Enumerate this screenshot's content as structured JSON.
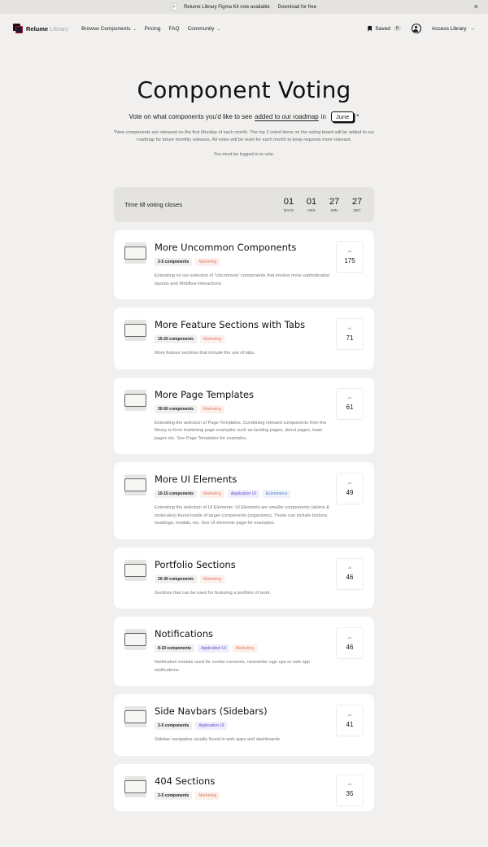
{
  "banner": {
    "message": "Relume Library Figma Kit now available",
    "cta": "Download for free",
    "close_icon": "×"
  },
  "nav": {
    "logo_primary": "Relume",
    "logo_secondary": "Library",
    "links": [
      {
        "label": "Browse Components",
        "dropdown": true
      },
      {
        "label": "Pricing",
        "dropdown": false
      },
      {
        "label": "FAQ",
        "dropdown": false
      },
      {
        "label": "Community",
        "dropdown": true
      }
    ],
    "saved_label": "Saved",
    "saved_count": "0",
    "access_label": "Access Library",
    "access_arrow": "→"
  },
  "hero": {
    "title": "Component Voting",
    "subtitle_pre": "Vote on what components you'd like to see",
    "subtitle_link": "added to our roadmap",
    "subtitle_in": "in",
    "month": "June",
    "asterisk": "*",
    "note": "*New components are released on the first Monday of each month. The top 2 voted items on the voting board will be added to our roadmap for future monthly releases. All votes will be reset for each month to keep requests more relevant.",
    "login_note": "You must be logged in to vote."
  },
  "timer": {
    "label": "Time till voting closes",
    "units": [
      {
        "value": "01",
        "caption": "DAYS"
      },
      {
        "value": "01",
        "caption": "HRS"
      },
      {
        "value": "27",
        "caption": "MIN"
      },
      {
        "value": "27",
        "caption": "SEC"
      }
    ]
  },
  "colors": {
    "background": "#f1f0ee",
    "marketing_tag": "#e07a5f",
    "appui_tag": "#5b4fc9",
    "ecommerce_tag": "#5479c4"
  },
  "cards": [
    {
      "title": "More Uncommon Components",
      "icon": "uncommon-components-icon",
      "tags": [
        {
          "label": "3-5 components",
          "kind": "count"
        },
        {
          "label": "Marketing",
          "kind": "marketing"
        }
      ],
      "description": "Extending on our selection of 'Uncommon' components that involve more sophisticated layouts and Webflow interactions.",
      "votes": "175"
    },
    {
      "title": "More Feature Sections with Tabs",
      "icon": "feature-tabs-icon",
      "tags": [
        {
          "label": "15-20 components",
          "kind": "count"
        },
        {
          "label": "Marketing",
          "kind": "marketing"
        }
      ],
      "description": "More feature sections that include the use of tabs.",
      "votes": "71"
    },
    {
      "title": "More Page Templates",
      "icon": "page-templates-icon",
      "tags": [
        {
          "label": "30-50 components",
          "kind": "count"
        },
        {
          "label": "Marketing",
          "kind": "marketing"
        }
      ],
      "description": "Extending the selection of Page Templates. Combining relevant components from the library to form marketing page examples such as landing pages, about pages, team pages etc. See Page Templates for examples.",
      "votes": "61"
    },
    {
      "title": "More UI Elements",
      "icon": "ui-elements-icon",
      "tags": [
        {
          "label": "10-15 components",
          "kind": "count"
        },
        {
          "label": "Marketing",
          "kind": "marketing"
        },
        {
          "label": "Application UI",
          "kind": "appui"
        },
        {
          "label": "Ecommerce",
          "kind": "ecom"
        }
      ],
      "description": "Extending the selection of UI Elements. UI Elements are smaller components (atoms & molecules) found inside of larger components (organisms). These can include buttons, headings, modals, etc. See UI elements page for examples.",
      "votes": "49"
    },
    {
      "title": "Portfolio Sections",
      "icon": "portfolio-sections-icon",
      "tags": [
        {
          "label": "20-30 components",
          "kind": "count"
        },
        {
          "label": "Marketing",
          "kind": "marketing"
        }
      ],
      "description": "Sections that can be used for featuring a portfolio of work.",
      "votes": "46"
    },
    {
      "title": "Notifications",
      "icon": "notifications-icon",
      "tags": [
        {
          "label": "8-10 components",
          "kind": "count"
        },
        {
          "label": "Application UI",
          "kind": "appui"
        },
        {
          "label": "Marketing",
          "kind": "marketing"
        }
      ],
      "description": "Notification modals used for cookie consents, newsletter sign ups or web app notifications.",
      "votes": "46"
    },
    {
      "title": "Side Navbars (Sidebars)",
      "icon": "sidebar-icon",
      "tags": [
        {
          "label": "3-5 components",
          "kind": "count"
        },
        {
          "label": "Application UI",
          "kind": "appui"
        }
      ],
      "description": "Sidebar navigation usually found in web apps and dashboards.",
      "votes": "41"
    },
    {
      "title": "404 Sections",
      "icon": "404-sections-icon",
      "tags": [
        {
          "label": "3-5 components",
          "kind": "count"
        },
        {
          "label": "Marketing",
          "kind": "marketing"
        }
      ],
      "description": "",
      "votes": "35"
    }
  ]
}
